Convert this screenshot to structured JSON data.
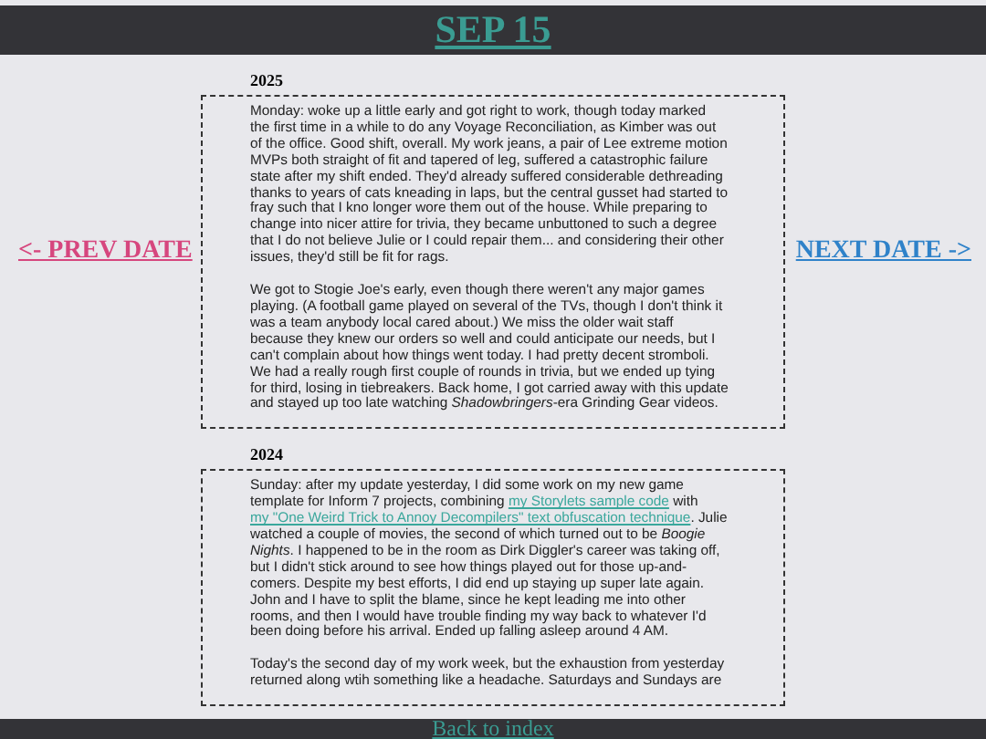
{
  "header": {
    "title": "SEP 15"
  },
  "nav": {
    "prev": "<- PREV DATE",
    "next": "NEXT DATE ->"
  },
  "entries": [
    {
      "year": "2025",
      "paragraphs": [
        [
          {
            "kind": "text",
            "text": "Monday: woke up a little early and got right to work, though today marked the first time in a while to do any Voyage Reconciliation, as Kimber was out of the office. Good shift, overall. My work jeans, a pair of Lee extreme motion MVPs both straight of fit and tapered of leg, suffered a catastrophic failure state after my shift ended. They'd already suffered considerable dethreading thanks to years of cats kneading in laps, but the central gusset had started to fray such that I kno longer wore them out of the house. While preparing to change into nicer attire for trivia, they became unbuttoned to such a degree that I do not believe Julie or I could repair them... and considering their other issues, they'd still be fit for rags."
          }
        ],
        [
          {
            "kind": "text",
            "text": "We got to Stogie Joe's early, even though there weren't any major games playing. (A football game played on several of the TVs, though I don't think it was a team anybody local cared about.) We miss the older wait staff because they knew our orders so well and could anticipate our needs, but I can't complain about how things went today. I had pretty decent stromboli. We had a really rough first couple of rounds in trivia, but we ended up tying for third, losing in tiebreakers. Back home, I got carried away with this update and stayed up too late watching *Shadowbringers*-era Grinding Gear videos."
          }
        ]
      ]
    },
    {
      "year": "2024",
      "paragraphs": [
        [
          {
            "kind": "text",
            "text": "Sunday: after my update yesterday, I did some work on my new game template for Inform 7 projects, combining "
          },
          {
            "kind": "link",
            "text": "my Storylets sample code"
          },
          {
            "kind": "text",
            "text": " with "
          },
          {
            "kind": "link",
            "text": "my \"One Weird Trick to Annoy Decompilers\" text obfuscation technique"
          },
          {
            "kind": "text",
            "text": ". Julie watched a couple of movies, the second of which turned out to be *Boogie Nights*. I happened to be in the room as Dirk Diggler's career was taking off, but I didn't stick around to see how things played out for those up-and-comers. Despite my best efforts, I did end up staying up super late again. John and I have to split the blame, since he kept leading me into other rooms, and then I would have trouble finding my way back to whatever I'd been doing before his arrival. Ended up falling asleep around 4 AM."
          }
        ],
        [
          {
            "kind": "text",
            "text": "Today's the second day of my work week, but the exhaustion from yesterday returned along wtih something like a headache. Saturdays and Sundays are"
          }
        ]
      ]
    }
  ],
  "footer": {
    "link": "Back to index"
  }
}
